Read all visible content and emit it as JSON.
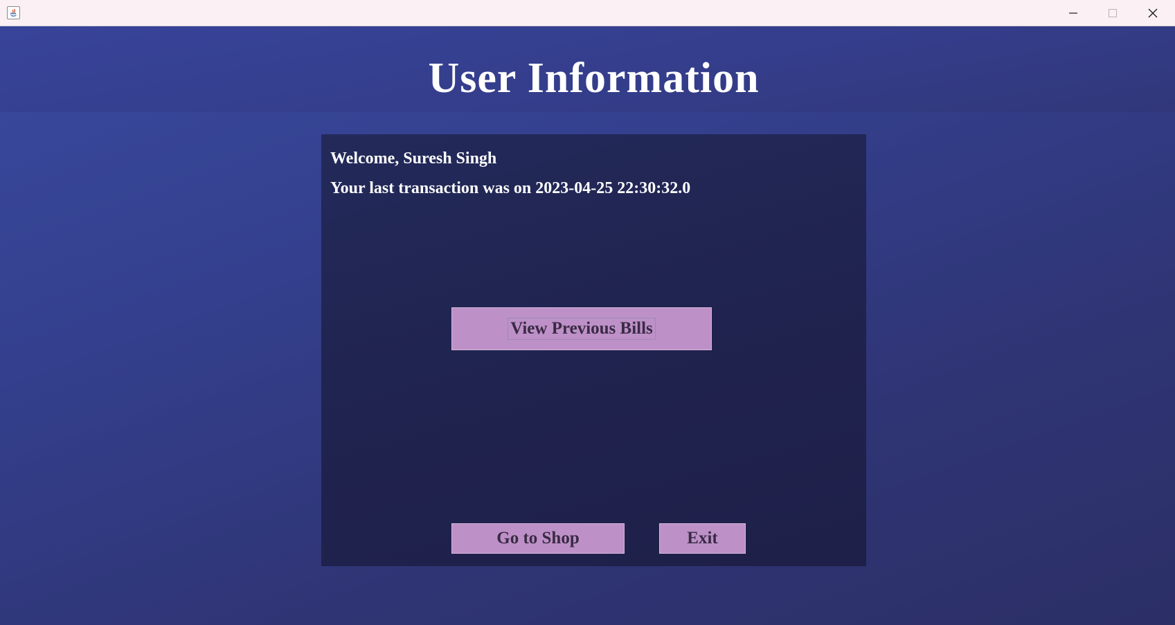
{
  "window": {
    "title": "",
    "controls": {
      "minimize_icon": "minimize-icon",
      "maximize_icon": "maximize-icon",
      "close_icon": "close-icon"
    }
  },
  "header": {
    "title": "User Information"
  },
  "panel": {
    "welcome_text": "Welcome, Suresh Singh",
    "last_transaction_text": "Your last transaction was on 2023-04-25 22:30:32.0",
    "view_bills_label": "View Previous Bills",
    "go_to_shop_label": "Go to Shop",
    "exit_label": "Exit"
  },
  "colors": {
    "background": "#34408e",
    "panel": "#20234f",
    "button": "#bd91c7",
    "button_text": "#3a2a45",
    "text": "#ffffff"
  }
}
